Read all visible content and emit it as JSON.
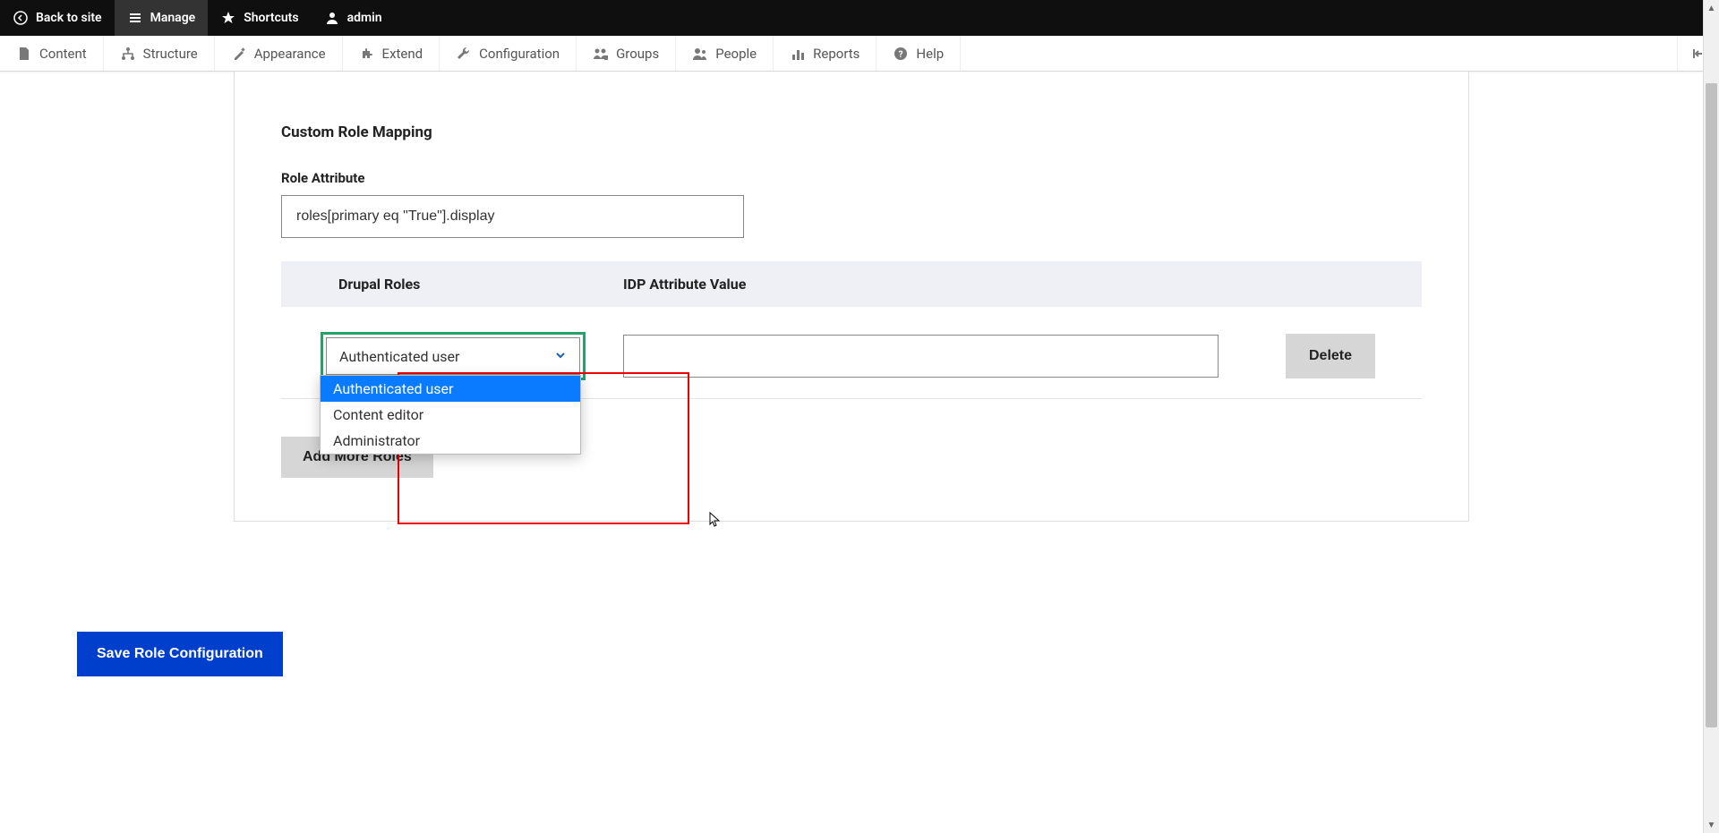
{
  "topbar": {
    "back": "Back to site",
    "manage": "Manage",
    "shortcuts": "Shortcuts",
    "user": "admin"
  },
  "adminmenu": {
    "items": [
      {
        "label": "Content"
      },
      {
        "label": "Structure"
      },
      {
        "label": "Appearance"
      },
      {
        "label": "Extend"
      },
      {
        "label": "Configuration"
      },
      {
        "label": "Groups"
      },
      {
        "label": "People"
      },
      {
        "label": "Reports"
      },
      {
        "label": "Help"
      }
    ]
  },
  "section_title": "Custom Role Mapping",
  "role_attr_label": "Role Attribute",
  "role_attr_value": "roles[primary eq \"True\"].display",
  "table": {
    "th_left": "Drupal Roles",
    "th_mid": "IDP Attribute Value"
  },
  "select_value": "Authenticated user",
  "options": [
    "Authenticated user",
    "Content editor",
    "Administrator"
  ],
  "idp_value": "",
  "delete_label": "Delete",
  "add_label": "Add More Roles",
  "save_label": "Save Role Configuration"
}
